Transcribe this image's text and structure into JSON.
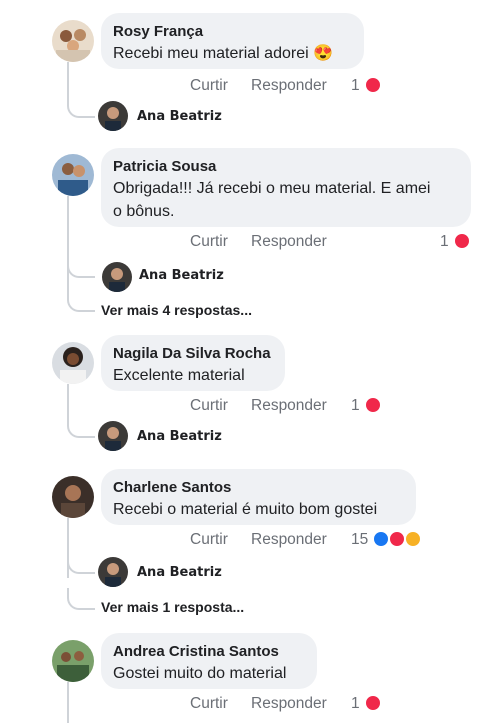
{
  "comments": [
    {
      "name": "Rosy França",
      "text": "Recebi meu material adorei",
      "emoji": "😍",
      "like": "Curtir",
      "reply": "Responder",
      "count": "1",
      "reply_author": "Ana Beatriz"
    },
    {
      "name": "Patricia Sousa",
      "text_line1": "Obrigada!!! Já recebi o meu material. E amei",
      "text_line2": "o bônus.",
      "like": "Curtir",
      "reply": "Responder",
      "count": "1",
      "reply_author": "Ana Beatriz",
      "more": "Ver mais 4 respostas..."
    },
    {
      "name": "Nagila Da Silva Rocha",
      "text": "Excelente material",
      "like": "Curtir",
      "reply": "Responder",
      "count": "1",
      "reply_author": "Ana Beatriz"
    },
    {
      "name": "Charlene Santos",
      "text": "Recebi o material é muito bom gostei",
      "like": "Curtir",
      "reply": "Responder",
      "count": "15",
      "reply_author": "Ana Beatriz",
      "more": "Ver mais 1 resposta..."
    },
    {
      "name": "Andrea Cristina Santos",
      "text": "Gostei muito do material",
      "like": "Curtir",
      "reply": "Responder",
      "count": "1"
    }
  ],
  "colors": {
    "heart": "#f0284a",
    "like": "#1877f2",
    "haha": "#f7b125",
    "bubble": "#eff1f4"
  }
}
